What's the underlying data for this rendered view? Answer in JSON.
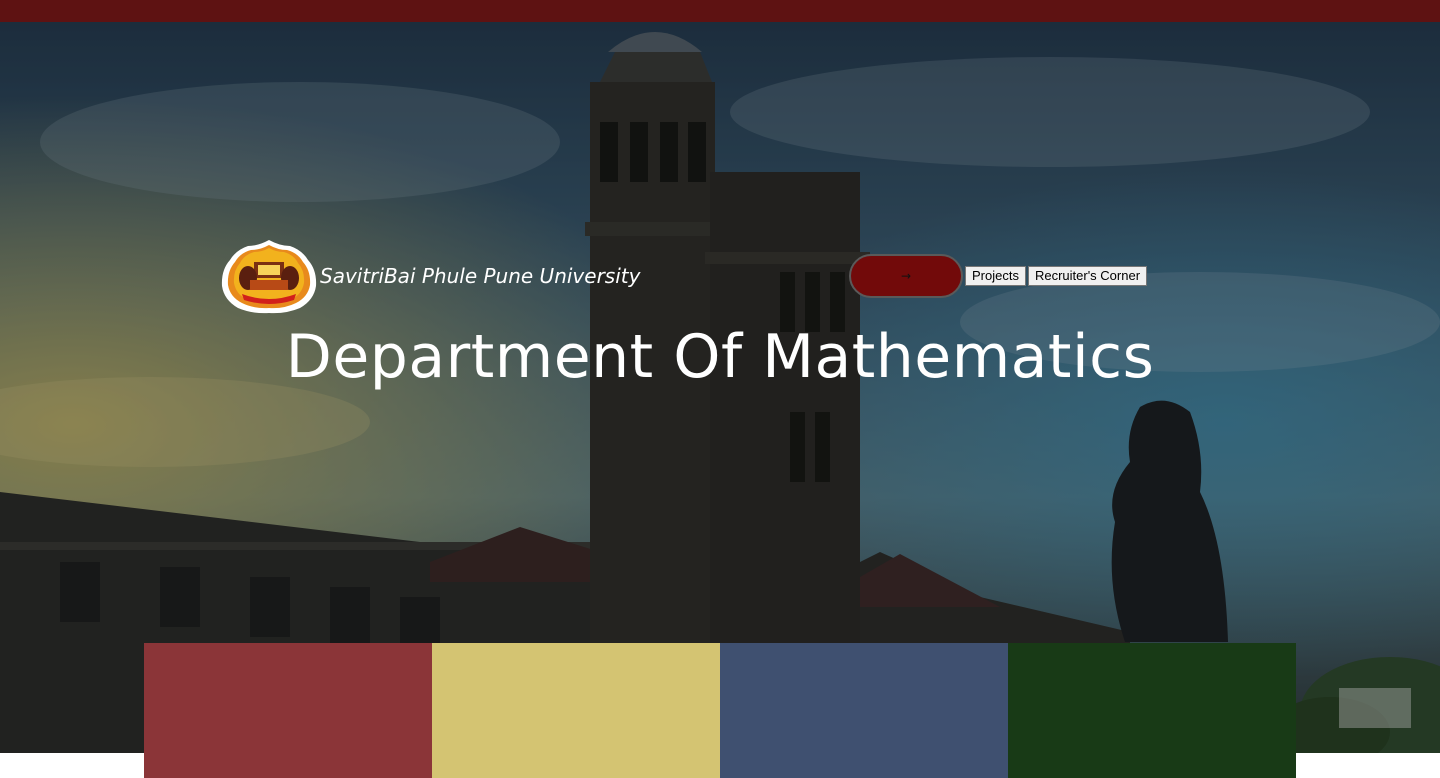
{
  "topbar": {
    "color": "#5e1212"
  },
  "header": {
    "logo_icon": "university-emblem-icon",
    "university_name": "SavitriBai Phule Pune University"
  },
  "nav": {
    "toggle_icon": "arrow-icon",
    "toggle_glyph": "→",
    "items": [
      {
        "label": "Projects"
      },
      {
        "label": "Recruiter's Corner"
      }
    ]
  },
  "hero": {
    "title": "Department Of Mathematics"
  },
  "swatches": [
    {
      "color": "#8b3538"
    },
    {
      "color": "#d4c472"
    },
    {
      "color": "#3f5070"
    },
    {
      "color": "#183a16"
    }
  ]
}
